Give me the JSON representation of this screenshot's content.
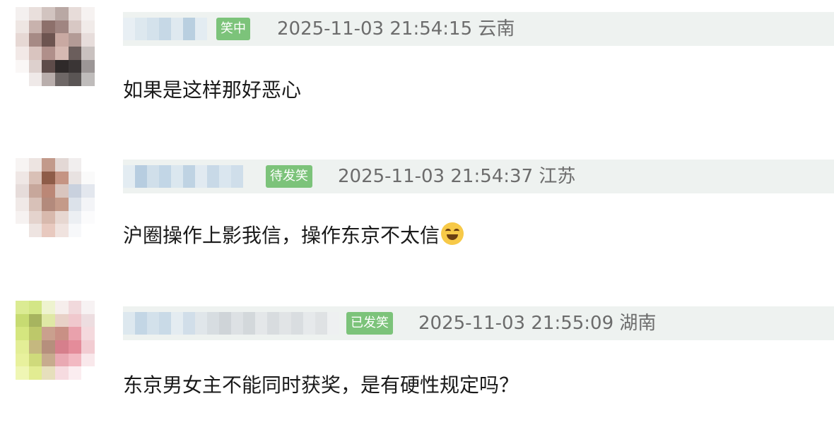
{
  "comments": [
    {
      "badge": "笑中",
      "timestamp": "2025-11-03 21:54:15",
      "location": "云南",
      "text": "如果是这样那好恶心"
    },
    {
      "badge": "待发笑",
      "timestamp": "2025-11-03 21:54:37",
      "location": "江苏",
      "text": "沪圈操作上影我信，操作东京不太信"
    },
    {
      "badge": "已发笑",
      "timestamp": "2025-11-03 21:55:09",
      "location": "湖南",
      "text": "东京男女主不能同时获奖，是有硬性规定吗？"
    }
  ],
  "icons": {
    "emoji": "face-with-tears-of-joy-icon",
    "avatar": "pixelated-avatar-icon"
  },
  "colors": {
    "badge": "#7cc37a",
    "meta_bar": "#eef2f0",
    "meta_text": "#6c6c6c",
    "body_text": "#1a1a1a"
  }
}
